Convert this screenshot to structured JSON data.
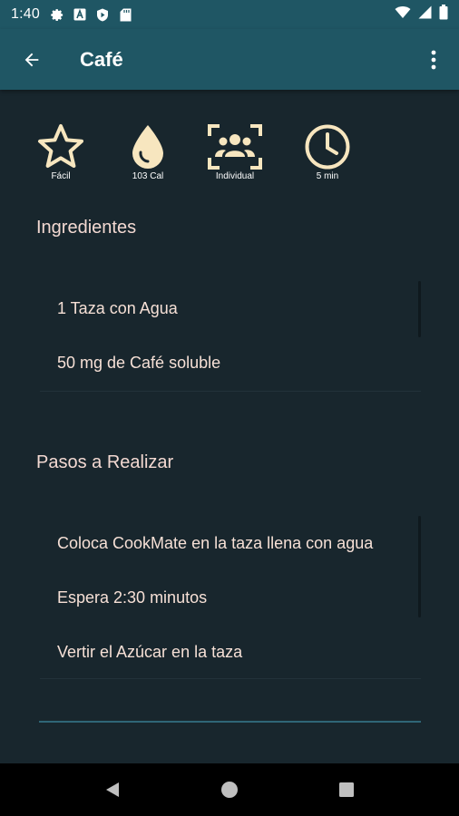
{
  "status_bar": {
    "time": "1:40",
    "left_icons": [
      "gear-icon",
      "a-box-icon",
      "shield-play-icon",
      "sd-card-icon"
    ],
    "right_icons": [
      "wifi-icon",
      "signal-icon",
      "battery-icon"
    ]
  },
  "app_bar": {
    "title": "Café",
    "back_icon": "arrow-left-icon",
    "menu_icon": "more-vertical-icon",
    "background": "#1f5664"
  },
  "stats": [
    {
      "icon": "star-icon",
      "label": "Fácil"
    },
    {
      "icon": "drop-icon",
      "label": "103 Cal"
    },
    {
      "icon": "people-icon",
      "label": "Individual"
    },
    {
      "icon": "clock-icon",
      "label": "5 min"
    }
  ],
  "ingredients": {
    "title": "Ingredientes",
    "items": [
      "1 Taza con Agua",
      "50 mg de Café soluble"
    ]
  },
  "steps": {
    "title": "Pasos a Realizar",
    "items": [
      "Coloca CookMate en la taza llena con agua",
      "Espera 2:30 minutos",
      "Vertir el Azúcar en la taza"
    ]
  },
  "colors": {
    "background": "#18262d",
    "accent_icon": "#f7e6bf",
    "text_light": "#f6e0d6",
    "divider": "#2f6677"
  },
  "nav_bar": {
    "buttons": [
      "back-triangle-icon",
      "home-circle-icon",
      "recents-square-icon"
    ]
  }
}
